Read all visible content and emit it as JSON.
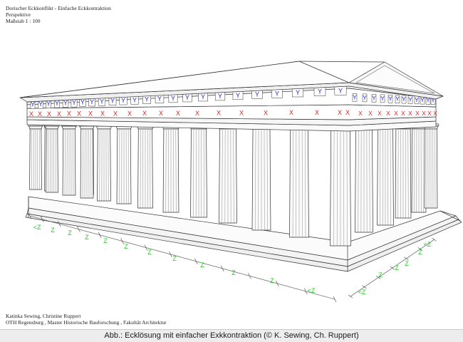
{
  "header": {
    "title": "Dorischer Eckkonflikt - Einfache Eckkontraktion",
    "view": "Perspektive",
    "scale": "Maßstab 1 : 100"
  },
  "credits": {
    "authors": "Katinka Sewing, Christine Ruppert",
    "institution": "OTH Regensburg , Master Historische Bauforschung , Fakultät Architektur"
  },
  "caption": "Abb.: Ecklösung mit einfacher Exkkontraktion (© K. Sewing, Ch. Ruppert)",
  "labels": {
    "triglyph": "Y",
    "metope": "X",
    "interval": "Z",
    "corner_interval": "<Z"
  },
  "colors": {
    "triglyph": "#2222cc",
    "metope": "#e02020",
    "interval": "#22cc22",
    "line": "#333333"
  }
}
